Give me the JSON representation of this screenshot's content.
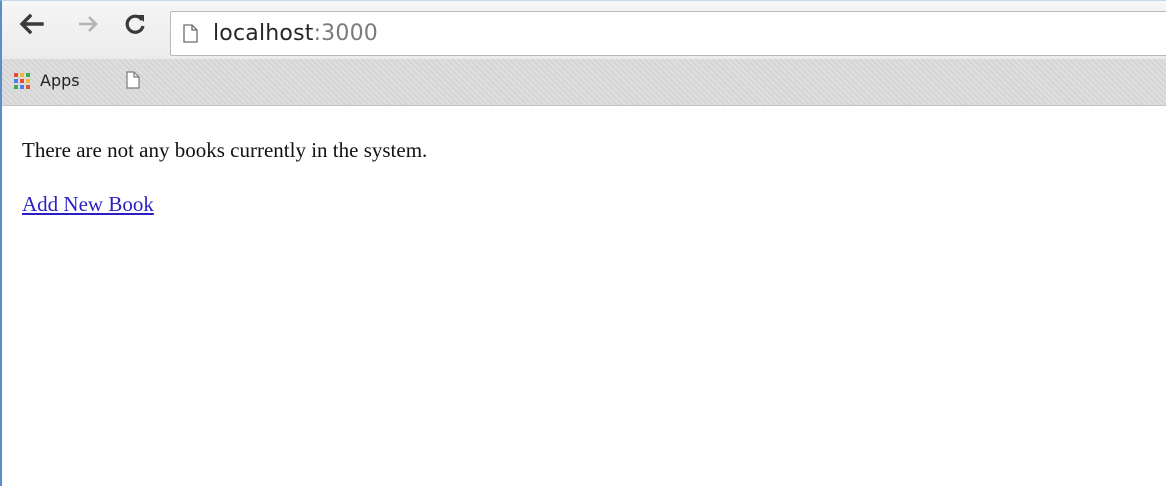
{
  "browser": {
    "url": {
      "host": "localhost",
      "port": ":3000"
    },
    "bookmarks_bar": {
      "apps_label": "Apps",
      "apps_grid_colors": [
        "#e34b3b",
        "#f2b72f",
        "#3ea955",
        "#4b7ee8",
        "#e34b3b",
        "#f2b72f",
        "#3ea955",
        "#4b7ee8",
        "#e34b3b"
      ]
    }
  },
  "page": {
    "message": "There are not any books currently in the system.",
    "add_link": "Add New Book"
  },
  "colors": {
    "link": "#2a1fc4",
    "window_border": "#5b8ec9"
  }
}
